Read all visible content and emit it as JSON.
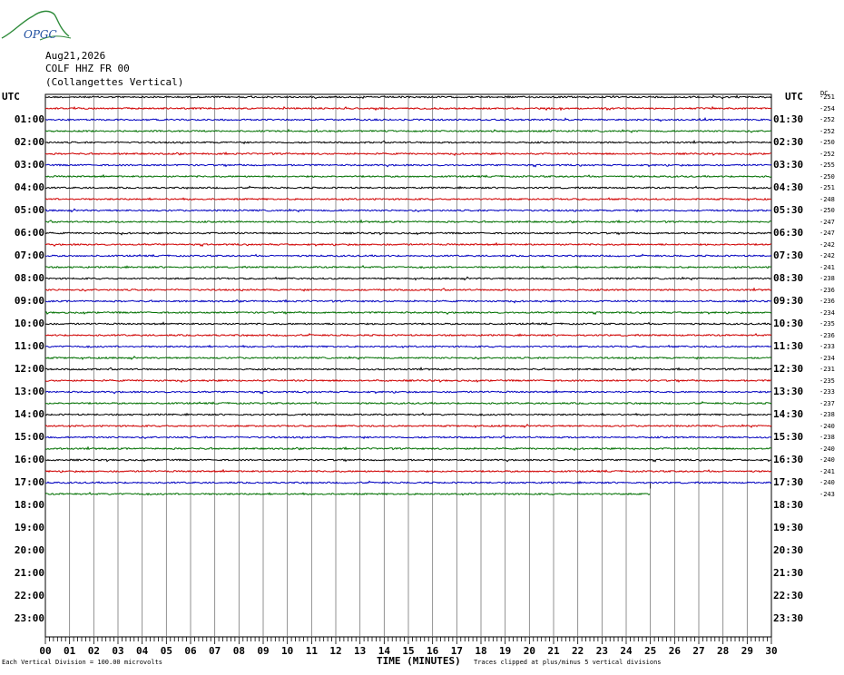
{
  "header": {
    "date": "Aug21,2026",
    "station": "COLF HHZ FR 00",
    "location": "(Collangettes Vertical)"
  },
  "logo": {
    "text": "OPGC",
    "icon": "mountain-logo-icon"
  },
  "axis": {
    "utc_left": "UTC",
    "utc_right": "UTC",
    "dc_label": "DC",
    "left_times": [
      "01:00",
      "02:00",
      "03:00",
      "04:00",
      "05:00",
      "06:00",
      "07:00",
      "08:00",
      "09:00",
      "10:00",
      "11:00",
      "12:00",
      "13:00",
      "14:00",
      "15:00",
      "16:00",
      "17:00",
      "18:00",
      "19:00",
      "20:00",
      "21:00",
      "22:00",
      "23:00"
    ],
    "right_times": [
      "01:30",
      "02:30",
      "03:30",
      "04:30",
      "05:30",
      "06:30",
      "07:30",
      "08:30",
      "09:30",
      "10:30",
      "11:30",
      "12:30",
      "13:30",
      "14:30",
      "15:30",
      "16:30",
      "17:30",
      "18:30",
      "19:30",
      "20:30",
      "21:30",
      "22:30",
      "23:30"
    ],
    "x_ticks": [
      "00",
      "01",
      "02",
      "03",
      "04",
      "05",
      "06",
      "07",
      "08",
      "09",
      "10",
      "11",
      "12",
      "13",
      "14",
      "15",
      "16",
      "17",
      "18",
      "19",
      "20",
      "21",
      "22",
      "23",
      "24",
      "25",
      "26",
      "27",
      "28",
      "29",
      "30"
    ],
    "x_title": "TIME (MINUTES)"
  },
  "dc_values": [
    "-251",
    "-254",
    "-252",
    "-252",
    "-250",
    "-252",
    "-255",
    "-250",
    "-251",
    "-248",
    "-250",
    "-247",
    "-247",
    "-242",
    "-242",
    "-241",
    "-238",
    "-236",
    "-236",
    "-234",
    "-235",
    "-236",
    "-233",
    "-234",
    "-231",
    "-235",
    "-233",
    "-237",
    "-238",
    "-240",
    "-238",
    "-240",
    "-240",
    "-241",
    "-240",
    "-243"
  ],
  "traces": {
    "count": 36,
    "colors": [
      "#000000",
      "#d00000",
      "#0000c0",
      "#007000"
    ],
    "last_trace_end_minute": 25
  },
  "footer": {
    "scale_note": "Each Vertical Division =  100.00 microvolts",
    "clip_note": "Traces clipped at plus/minus 5 vertical divisions"
  }
}
